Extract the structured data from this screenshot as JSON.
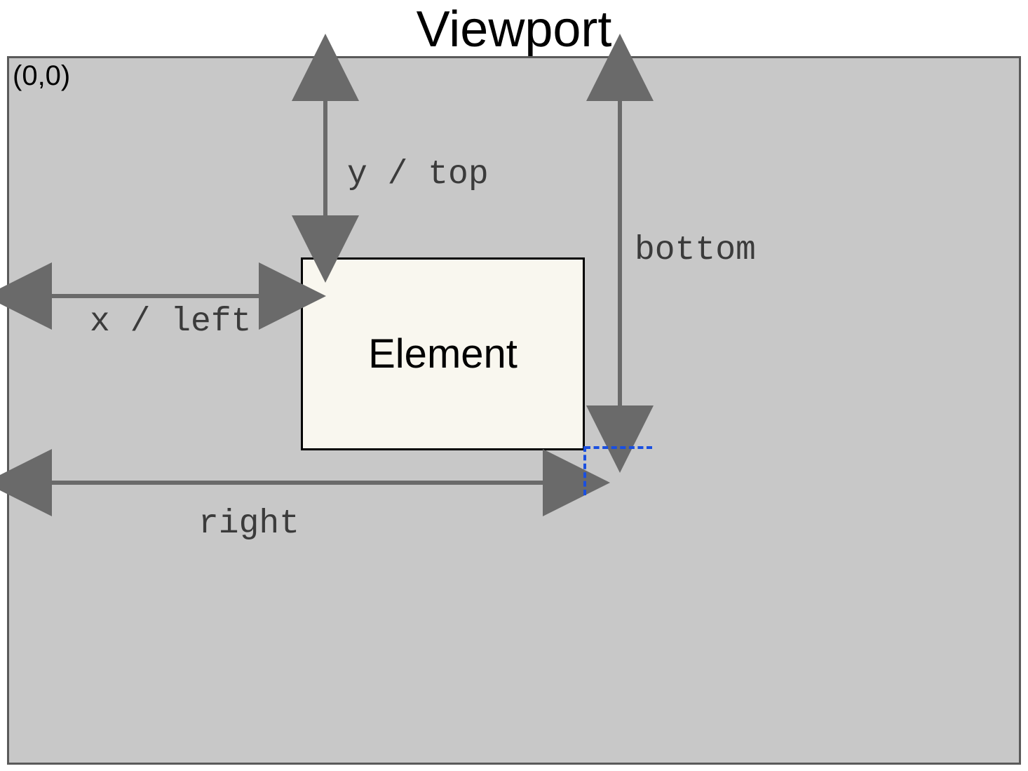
{
  "title": "Viewport",
  "origin": "(0,0)",
  "element_label": "Element",
  "labels": {
    "ytop": "y / top",
    "xleft": "x / left",
    "bottom": "bottom",
    "right": "right"
  }
}
